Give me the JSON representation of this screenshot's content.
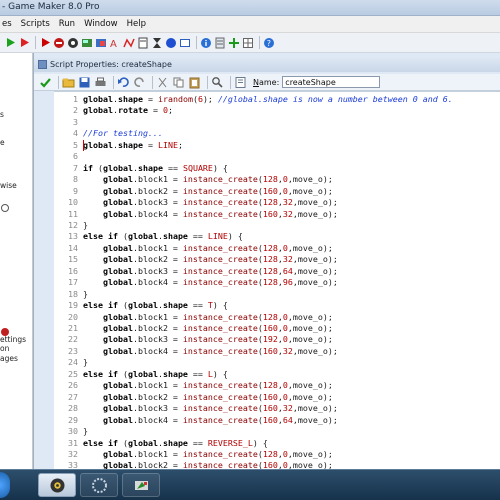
{
  "app": {
    "title": "- Game Maker 8.0 Pro"
  },
  "menu": {
    "items": [
      "es",
      "Scripts",
      "Run",
      "Window",
      "Help"
    ]
  },
  "toolbar": {
    "icons": [
      "run-green-icon",
      "run-debug-icon",
      "stop-icon",
      "script-icon",
      "sprite-icon",
      "background-icon",
      "font-icon",
      "path-icon",
      "timeline-icon",
      "object-icon",
      "room-icon",
      "info-icon",
      "settings-icon",
      "extension-icon",
      "help-icon"
    ]
  },
  "left_tree": {
    "fragments": [
      "s",
      "e",
      "wise",
      "on",
      "ettings",
      "ages"
    ]
  },
  "script_window": {
    "title": "Script Properties: createShape",
    "name_label_prefix": "",
    "name_label_underlined": "N",
    "name_label_suffix": "ame:",
    "name_value": "createShape"
  },
  "code": {
    "lines": [
      {
        "n": "1",
        "segs": [
          [
            "kw",
            "global"
          ],
          [
            "",
            "."
          ],
          [
            "kw",
            "shape"
          ],
          [
            "",
            " = "
          ],
          [
            "fn",
            "irandom"
          ],
          [
            "",
            "("
          ],
          [
            "num",
            "6"
          ],
          [
            "",
            "); "
          ],
          [
            "cm",
            "//global.shape is now a number between 0 and 6."
          ]
        ]
      },
      {
        "n": "2",
        "segs": [
          [
            "kw",
            "global"
          ],
          [
            "",
            "."
          ],
          [
            "kw",
            "rotate"
          ],
          [
            "",
            " = "
          ],
          [
            "num",
            "0"
          ],
          [
            "",
            ";"
          ]
        ]
      },
      {
        "n": "3",
        "segs": []
      },
      {
        "n": "4",
        "segs": [
          [
            "cm",
            "//For testing..."
          ]
        ]
      },
      {
        "n": "5",
        "segs": [
          [
            "kw",
            "global"
          ],
          [
            "",
            "."
          ],
          [
            "kw",
            "shape"
          ],
          [
            "",
            " = "
          ],
          [
            "cn",
            "LINE"
          ],
          [
            "",
            ";"
          ]
        ]
      },
      {
        "n": "6",
        "segs": []
      },
      {
        "n": "7",
        "segs": [
          [
            "kw",
            "if"
          ],
          [
            "",
            " ("
          ],
          [
            "kw",
            "global"
          ],
          [
            "",
            "."
          ],
          [
            "kw",
            "shape"
          ],
          [
            "",
            " == "
          ],
          [
            "cn",
            "SQUARE"
          ],
          [
            "",
            ") {"
          ]
        ]
      },
      {
        "n": "8",
        "segs": [
          [
            "",
            "    "
          ],
          [
            "kw",
            "global"
          ],
          [
            "",
            ".block1 = "
          ],
          [
            "fn",
            "instance_create"
          ],
          [
            "",
            "("
          ],
          [
            "num",
            "128"
          ],
          [
            "",
            ","
          ],
          [
            "num",
            "0"
          ],
          [
            "",
            ",move_o);"
          ]
        ]
      },
      {
        "n": "9",
        "segs": [
          [
            "",
            "    "
          ],
          [
            "kw",
            "global"
          ],
          [
            "",
            ".block2 = "
          ],
          [
            "fn",
            "instance_create"
          ],
          [
            "",
            "("
          ],
          [
            "num",
            "160"
          ],
          [
            "",
            ","
          ],
          [
            "num",
            "0"
          ],
          [
            "",
            ",move_o);"
          ]
        ]
      },
      {
        "n": "10",
        "segs": [
          [
            "",
            "    "
          ],
          [
            "kw",
            "global"
          ],
          [
            "",
            ".block3 = "
          ],
          [
            "fn",
            "instance_create"
          ],
          [
            "",
            "("
          ],
          [
            "num",
            "128"
          ],
          [
            "",
            ","
          ],
          [
            "num",
            "32"
          ],
          [
            "",
            ",move_o);"
          ]
        ]
      },
      {
        "n": "11",
        "segs": [
          [
            "",
            "    "
          ],
          [
            "kw",
            "global"
          ],
          [
            "",
            ".block4 = "
          ],
          [
            "fn",
            "instance_create"
          ],
          [
            "",
            "("
          ],
          [
            "num",
            "160"
          ],
          [
            "",
            ","
          ],
          [
            "num",
            "32"
          ],
          [
            "",
            ",move_o);"
          ]
        ]
      },
      {
        "n": "12",
        "segs": [
          [
            "",
            "}"
          ]
        ]
      },
      {
        "n": "13",
        "segs": [
          [
            "kw",
            "else if"
          ],
          [
            "",
            " ("
          ],
          [
            "kw",
            "global"
          ],
          [
            "",
            "."
          ],
          [
            "kw",
            "shape"
          ],
          [
            "",
            " == "
          ],
          [
            "cn",
            "LINE"
          ],
          [
            "",
            ") {"
          ]
        ]
      },
      {
        "n": "14",
        "segs": [
          [
            "",
            "    "
          ],
          [
            "kw",
            "global"
          ],
          [
            "",
            ".block1 = "
          ],
          [
            "fn",
            "instance_create"
          ],
          [
            "",
            "("
          ],
          [
            "num",
            "128"
          ],
          [
            "",
            ","
          ],
          [
            "num",
            "0"
          ],
          [
            "",
            ",move_o);"
          ]
        ]
      },
      {
        "n": "15",
        "segs": [
          [
            "",
            "    "
          ],
          [
            "kw",
            "global"
          ],
          [
            "",
            ".block2 = "
          ],
          [
            "fn",
            "instance_create"
          ],
          [
            "",
            "("
          ],
          [
            "num",
            "128"
          ],
          [
            "",
            ","
          ],
          [
            "num",
            "32"
          ],
          [
            "",
            ",move_o);"
          ]
        ]
      },
      {
        "n": "16",
        "segs": [
          [
            "",
            "    "
          ],
          [
            "kw",
            "global"
          ],
          [
            "",
            ".block3 = "
          ],
          [
            "fn",
            "instance_create"
          ],
          [
            "",
            "("
          ],
          [
            "num",
            "128"
          ],
          [
            "",
            ","
          ],
          [
            "num",
            "64"
          ],
          [
            "",
            ",move_o);"
          ]
        ]
      },
      {
        "n": "17",
        "segs": [
          [
            "",
            "    "
          ],
          [
            "kw",
            "global"
          ],
          [
            "",
            ".block4 = "
          ],
          [
            "fn",
            "instance_create"
          ],
          [
            "",
            "("
          ],
          [
            "num",
            "128"
          ],
          [
            "",
            ","
          ],
          [
            "num",
            "96"
          ],
          [
            "",
            ",move_o);"
          ]
        ]
      },
      {
        "n": "18",
        "segs": [
          [
            "",
            "}"
          ]
        ]
      },
      {
        "n": "19",
        "segs": [
          [
            "kw",
            "else if"
          ],
          [
            "",
            " ("
          ],
          [
            "kw",
            "global"
          ],
          [
            "",
            "."
          ],
          [
            "kw",
            "shape"
          ],
          [
            "",
            " == "
          ],
          [
            "cn",
            "T"
          ],
          [
            "",
            ") {"
          ]
        ]
      },
      {
        "n": "20",
        "segs": [
          [
            "",
            "    "
          ],
          [
            "kw",
            "global"
          ],
          [
            "",
            ".block1 = "
          ],
          [
            "fn",
            "instance_create"
          ],
          [
            "",
            "("
          ],
          [
            "num",
            "128"
          ],
          [
            "",
            ","
          ],
          [
            "num",
            "0"
          ],
          [
            "",
            ",move_o);"
          ]
        ]
      },
      {
        "n": "21",
        "segs": [
          [
            "",
            "    "
          ],
          [
            "kw",
            "global"
          ],
          [
            "",
            ".block2 = "
          ],
          [
            "fn",
            "instance_create"
          ],
          [
            "",
            "("
          ],
          [
            "num",
            "160"
          ],
          [
            "",
            ","
          ],
          [
            "num",
            "0"
          ],
          [
            "",
            ",move_o);"
          ]
        ]
      },
      {
        "n": "22",
        "segs": [
          [
            "",
            "    "
          ],
          [
            "kw",
            "global"
          ],
          [
            "",
            ".block3 = "
          ],
          [
            "fn",
            "instance_create"
          ],
          [
            "",
            "("
          ],
          [
            "num",
            "192"
          ],
          [
            "",
            ","
          ],
          [
            "num",
            "0"
          ],
          [
            "",
            ",move_o);"
          ]
        ]
      },
      {
        "n": "23",
        "segs": [
          [
            "",
            "    "
          ],
          [
            "kw",
            "global"
          ],
          [
            "",
            ".block4 = "
          ],
          [
            "fn",
            "instance_create"
          ],
          [
            "",
            "("
          ],
          [
            "num",
            "160"
          ],
          [
            "",
            ","
          ],
          [
            "num",
            "32"
          ],
          [
            "",
            ",move_o);"
          ]
        ]
      },
      {
        "n": "24",
        "segs": [
          [
            "",
            "}"
          ]
        ]
      },
      {
        "n": "25",
        "segs": [
          [
            "kw",
            "else if"
          ],
          [
            "",
            " ("
          ],
          [
            "kw",
            "global"
          ],
          [
            "",
            "."
          ],
          [
            "kw",
            "shape"
          ],
          [
            "",
            " == "
          ],
          [
            "cn",
            "L"
          ],
          [
            "",
            ") {"
          ]
        ]
      },
      {
        "n": "26",
        "segs": [
          [
            "",
            "    "
          ],
          [
            "kw",
            "global"
          ],
          [
            "",
            ".block1 = "
          ],
          [
            "fn",
            "instance_create"
          ],
          [
            "",
            "("
          ],
          [
            "num",
            "128"
          ],
          [
            "",
            ","
          ],
          [
            "num",
            "0"
          ],
          [
            "",
            ",move_o);"
          ]
        ]
      },
      {
        "n": "27",
        "segs": [
          [
            "",
            "    "
          ],
          [
            "kw",
            "global"
          ],
          [
            "",
            ".block2 = "
          ],
          [
            "fn",
            "instance_create"
          ],
          [
            "",
            "("
          ],
          [
            "num",
            "160"
          ],
          [
            "",
            ","
          ],
          [
            "num",
            "0"
          ],
          [
            "",
            ",move_o);"
          ]
        ]
      },
      {
        "n": "28",
        "segs": [
          [
            "",
            "    "
          ],
          [
            "kw",
            "global"
          ],
          [
            "",
            ".block3 = "
          ],
          [
            "fn",
            "instance_create"
          ],
          [
            "",
            "("
          ],
          [
            "num",
            "160"
          ],
          [
            "",
            ","
          ],
          [
            "num",
            "32"
          ],
          [
            "",
            ",move_o);"
          ]
        ]
      },
      {
        "n": "29",
        "segs": [
          [
            "",
            "    "
          ],
          [
            "kw",
            "global"
          ],
          [
            "",
            ".block4 = "
          ],
          [
            "fn",
            "instance_create"
          ],
          [
            "",
            "("
          ],
          [
            "num",
            "160"
          ],
          [
            "",
            ","
          ],
          [
            "num",
            "64"
          ],
          [
            "",
            ",move_o);"
          ]
        ]
      },
      {
        "n": "30",
        "segs": [
          [
            "",
            "}"
          ]
        ]
      },
      {
        "n": "31",
        "segs": [
          [
            "kw",
            "else if"
          ],
          [
            "",
            " ("
          ],
          [
            "kw",
            "global"
          ],
          [
            "",
            "."
          ],
          [
            "kw",
            "shape"
          ],
          [
            "",
            " == "
          ],
          [
            "cn",
            "REVERSE_L"
          ],
          [
            "",
            ") {"
          ]
        ]
      },
      {
        "n": "32",
        "segs": [
          [
            "",
            "    "
          ],
          [
            "kw",
            "global"
          ],
          [
            "",
            ".block1 = "
          ],
          [
            "fn",
            "instance_create"
          ],
          [
            "",
            "("
          ],
          [
            "num",
            "128"
          ],
          [
            "",
            ","
          ],
          [
            "num",
            "0"
          ],
          [
            "",
            ",move_o);"
          ]
        ]
      },
      {
        "n": "33",
        "segs": [
          [
            "",
            "    "
          ],
          [
            "kw",
            "global"
          ],
          [
            "",
            ".block2 = "
          ],
          [
            "fn",
            "instance_create"
          ],
          [
            "",
            "("
          ],
          [
            "num",
            "160"
          ],
          [
            "",
            ","
          ],
          [
            "num",
            "0"
          ],
          [
            "",
            ",move_o);"
          ]
        ]
      }
    ],
    "caret_line": 5
  },
  "taskbar": {
    "items": [
      "game-maker-task-icon",
      "app-task-icon",
      "tool-task-icon"
    ]
  },
  "colors": {
    "keyword": "#000000",
    "function": "#8b0000",
    "comment": "#1a3cd8",
    "constant": "#b00000",
    "caret": "#cc0000"
  }
}
